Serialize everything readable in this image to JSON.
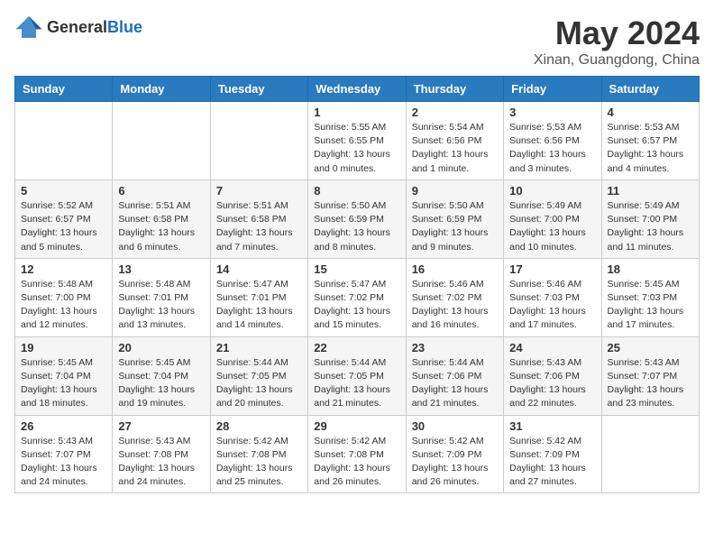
{
  "logo": {
    "text_general": "General",
    "text_blue": "Blue"
  },
  "title": {
    "month_year": "May 2024",
    "location": "Xinan, Guangdong, China"
  },
  "weekdays": [
    "Sunday",
    "Monday",
    "Tuesday",
    "Wednesday",
    "Thursday",
    "Friday",
    "Saturday"
  ],
  "weeks": [
    [
      {
        "day": "",
        "info": ""
      },
      {
        "day": "",
        "info": ""
      },
      {
        "day": "",
        "info": ""
      },
      {
        "day": "1",
        "info": "Sunrise: 5:55 AM\nSunset: 6:55 PM\nDaylight: 13 hours\nand 0 minutes."
      },
      {
        "day": "2",
        "info": "Sunrise: 5:54 AM\nSunset: 6:56 PM\nDaylight: 13 hours\nand 1 minute."
      },
      {
        "day": "3",
        "info": "Sunrise: 5:53 AM\nSunset: 6:56 PM\nDaylight: 13 hours\nand 3 minutes."
      },
      {
        "day": "4",
        "info": "Sunrise: 5:53 AM\nSunset: 6:57 PM\nDaylight: 13 hours\nand 4 minutes."
      }
    ],
    [
      {
        "day": "5",
        "info": "Sunrise: 5:52 AM\nSunset: 6:57 PM\nDaylight: 13 hours\nand 5 minutes."
      },
      {
        "day": "6",
        "info": "Sunrise: 5:51 AM\nSunset: 6:58 PM\nDaylight: 13 hours\nand 6 minutes."
      },
      {
        "day": "7",
        "info": "Sunrise: 5:51 AM\nSunset: 6:58 PM\nDaylight: 13 hours\nand 7 minutes."
      },
      {
        "day": "8",
        "info": "Sunrise: 5:50 AM\nSunset: 6:59 PM\nDaylight: 13 hours\nand 8 minutes."
      },
      {
        "day": "9",
        "info": "Sunrise: 5:50 AM\nSunset: 6:59 PM\nDaylight: 13 hours\nand 9 minutes."
      },
      {
        "day": "10",
        "info": "Sunrise: 5:49 AM\nSunset: 7:00 PM\nDaylight: 13 hours\nand 10 minutes."
      },
      {
        "day": "11",
        "info": "Sunrise: 5:49 AM\nSunset: 7:00 PM\nDaylight: 13 hours\nand 11 minutes."
      }
    ],
    [
      {
        "day": "12",
        "info": "Sunrise: 5:48 AM\nSunset: 7:00 PM\nDaylight: 13 hours\nand 12 minutes."
      },
      {
        "day": "13",
        "info": "Sunrise: 5:48 AM\nSunset: 7:01 PM\nDaylight: 13 hours\nand 13 minutes."
      },
      {
        "day": "14",
        "info": "Sunrise: 5:47 AM\nSunset: 7:01 PM\nDaylight: 13 hours\nand 14 minutes."
      },
      {
        "day": "15",
        "info": "Sunrise: 5:47 AM\nSunset: 7:02 PM\nDaylight: 13 hours\nand 15 minutes."
      },
      {
        "day": "16",
        "info": "Sunrise: 5:46 AM\nSunset: 7:02 PM\nDaylight: 13 hours\nand 16 minutes."
      },
      {
        "day": "17",
        "info": "Sunrise: 5:46 AM\nSunset: 7:03 PM\nDaylight: 13 hours\nand 17 minutes."
      },
      {
        "day": "18",
        "info": "Sunrise: 5:45 AM\nSunset: 7:03 PM\nDaylight: 13 hours\nand 17 minutes."
      }
    ],
    [
      {
        "day": "19",
        "info": "Sunrise: 5:45 AM\nSunset: 7:04 PM\nDaylight: 13 hours\nand 18 minutes."
      },
      {
        "day": "20",
        "info": "Sunrise: 5:45 AM\nSunset: 7:04 PM\nDaylight: 13 hours\nand 19 minutes."
      },
      {
        "day": "21",
        "info": "Sunrise: 5:44 AM\nSunset: 7:05 PM\nDaylight: 13 hours\nand 20 minutes."
      },
      {
        "day": "22",
        "info": "Sunrise: 5:44 AM\nSunset: 7:05 PM\nDaylight: 13 hours\nand 21 minutes."
      },
      {
        "day": "23",
        "info": "Sunrise: 5:44 AM\nSunset: 7:06 PM\nDaylight: 13 hours\nand 21 minutes."
      },
      {
        "day": "24",
        "info": "Sunrise: 5:43 AM\nSunset: 7:06 PM\nDaylight: 13 hours\nand 22 minutes."
      },
      {
        "day": "25",
        "info": "Sunrise: 5:43 AM\nSunset: 7:07 PM\nDaylight: 13 hours\nand 23 minutes."
      }
    ],
    [
      {
        "day": "26",
        "info": "Sunrise: 5:43 AM\nSunset: 7:07 PM\nDaylight: 13 hours\nand 24 minutes."
      },
      {
        "day": "27",
        "info": "Sunrise: 5:43 AM\nSunset: 7:08 PM\nDaylight: 13 hours\nand 24 minutes."
      },
      {
        "day": "28",
        "info": "Sunrise: 5:42 AM\nSunset: 7:08 PM\nDaylight: 13 hours\nand 25 minutes."
      },
      {
        "day": "29",
        "info": "Sunrise: 5:42 AM\nSunset: 7:08 PM\nDaylight: 13 hours\nand 26 minutes."
      },
      {
        "day": "30",
        "info": "Sunrise: 5:42 AM\nSunset: 7:09 PM\nDaylight: 13 hours\nand 26 minutes."
      },
      {
        "day": "31",
        "info": "Sunrise: 5:42 AM\nSunset: 7:09 PM\nDaylight: 13 hours\nand 27 minutes."
      },
      {
        "day": "",
        "info": ""
      }
    ]
  ]
}
